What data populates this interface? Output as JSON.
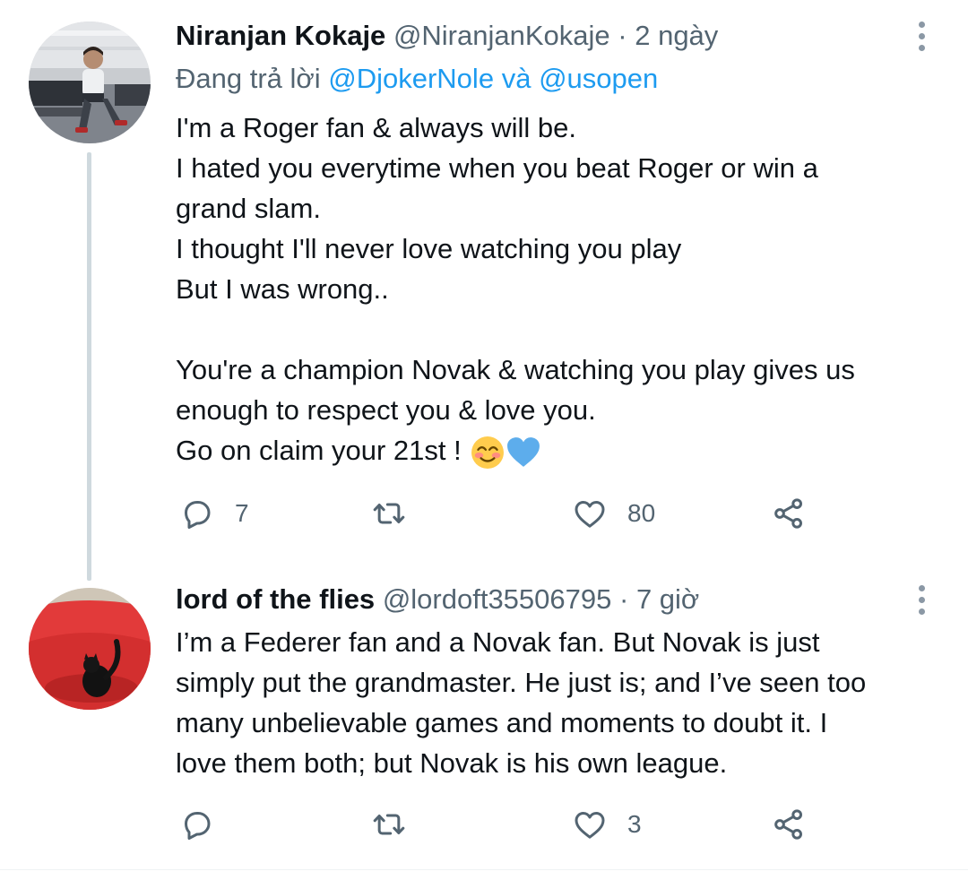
{
  "tweets": [
    {
      "author_name": "Niranjan Kokaje",
      "handle": "@NiranjanKokaje",
      "separator": "·",
      "time": "2 ngày",
      "reply_prefix": "Đang trả lời",
      "reply_mention_1": "@DjokerNole",
      "reply_conjunction": "và",
      "reply_mention_2": "@usopen",
      "lines": [
        "I'm a Roger fan & always will be.",
        "I hated you everytime when you beat Roger or win a",
        "grand slam.",
        "I thought I'll never love watching you play",
        "But I was wrong..",
        "",
        "You're a champion Novak & watching you play gives us",
        "enough to respect you & love you.",
        "Go on claim your 21st !"
      ],
      "emojis": [
        "smiling-face-with-smiling-eyes",
        "blue-heart"
      ],
      "reply_count": "7",
      "retweet_count": "",
      "like_count": "80"
    },
    {
      "author_name": "lord of the flies",
      "handle": "@lordoft35506795",
      "separator": "·",
      "time": "7 giờ",
      "lines": [
        "I’m a Federer fan and a Novak fan. But Novak is just",
        "simply put the grandmaster. He just is; and I’ve seen too",
        "many unbelievable games and moments to doubt it. I",
        "love them both; but Novak is his own league."
      ],
      "reply_count": "",
      "retweet_count": "",
      "like_count": "3"
    }
  ],
  "icons": {
    "reply": "speech-bubble-icon",
    "retweet": "retweet-icon",
    "like": "heart-icon",
    "share": "share-icon",
    "more": "more-vertical-icon"
  },
  "colors": {
    "text_primary": "#0f1419",
    "text_secondary": "#536471",
    "link": "#1d9bf0",
    "thread_line": "#cfd9de"
  }
}
